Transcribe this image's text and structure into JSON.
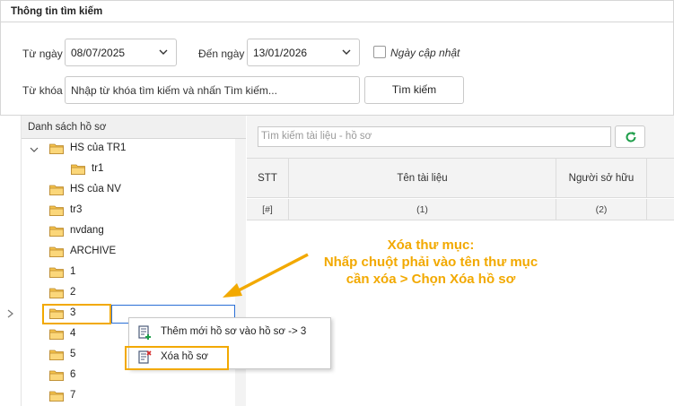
{
  "search_panel": {
    "title": "Thông tin tìm kiếm",
    "from_date_label": "Từ ngày",
    "from_date_value": "08/07/2025",
    "to_date_label": "Đến ngày",
    "to_date_value": "13/01/2026",
    "update_date_label": "Ngày cập nhật",
    "keyword_label": "Từ khóa",
    "keyword_placeholder": "Nhập từ khóa tìm kiếm và nhấn Tìm kiếm...",
    "search_button": "Tìm kiếm"
  },
  "tree": {
    "header": "Danh sách hồ sơ",
    "items": [
      {
        "label": "HS của TR1"
      },
      {
        "label": "tr1"
      },
      {
        "label": "HS của NV"
      },
      {
        "label": "tr3"
      },
      {
        "label": "nvdang"
      },
      {
        "label": "ARCHIVE"
      },
      {
        "label": "1"
      },
      {
        "label": "2"
      },
      {
        "label": "3"
      },
      {
        "label": "4"
      },
      {
        "label": "5"
      },
      {
        "label": "6"
      },
      {
        "label": "7"
      }
    ]
  },
  "documents": {
    "search_placeholder": "Tìm kiếm tài liệu - hồ sơ",
    "columns": [
      {
        "header": "STT",
        "sub": "[#]"
      },
      {
        "header": "Tên tài liệu",
        "sub": "(1)"
      },
      {
        "header": "Người sở hữu",
        "sub": "(2)"
      }
    ]
  },
  "context_menu": {
    "items": [
      {
        "label": "Thêm mới hồ sơ vào hồ sơ  -> 3"
      },
      {
        "label": "Xóa hồ sơ"
      }
    ]
  },
  "annotation": {
    "line1": "Xóa thư mục:",
    "line2": "Nhấp chuột phải vào tên thư mục",
    "line3": "cần xóa > Chọn Xóa hồ sơ"
  },
  "colors": {
    "highlight": "#f2a900",
    "folder": "#f5c24b",
    "refresh": "#1e9e4a",
    "selection": "#2a6fd6"
  }
}
